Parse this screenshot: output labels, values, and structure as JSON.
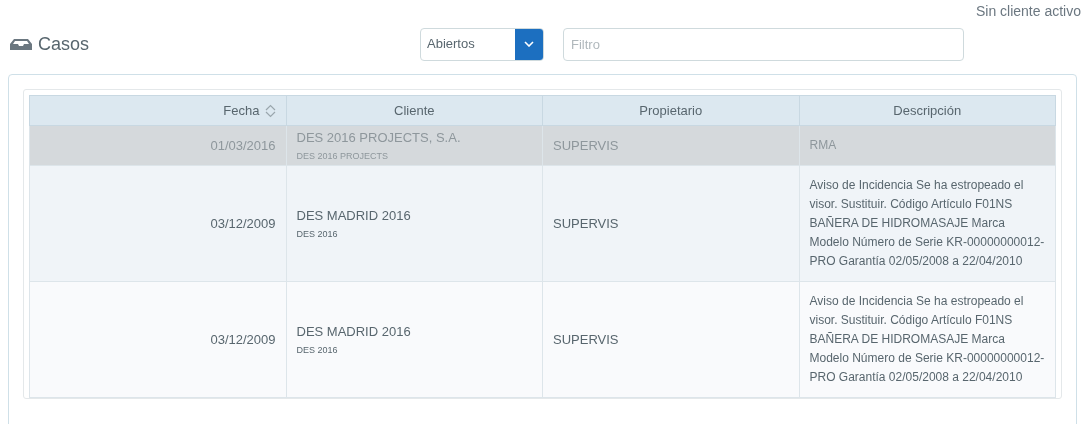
{
  "status": "Sin cliente activo",
  "title": "Casos",
  "state_select": {
    "value": "Abiertos"
  },
  "filter": {
    "placeholder": "Filtro"
  },
  "table": {
    "columns": [
      {
        "label": "Fecha",
        "sortable": true
      },
      {
        "label": "Cliente",
        "sortable": false
      },
      {
        "label": "Propietario",
        "sortable": false
      },
      {
        "label": "Descripción",
        "sortable": false
      }
    ],
    "rows": [
      {
        "selected": true,
        "date": "01/03/2016",
        "client": "DES 2016 PROJECTS, S.A.",
        "client_short": "DES 2016 PROJECTS",
        "owner": "SUPERVIS",
        "description": "RMA"
      },
      {
        "selected": false,
        "date": "03/12/2009",
        "client": "DES MADRID 2016",
        "client_short": "DES 2016",
        "owner": "SUPERVIS",
        "description": "Aviso de Incidencia Se ha estropeado el visor. Sustituir. Código Artículo F01NS BAÑERA DE HIDROMASAJE Marca Modelo Número de Serie KR-00000000012-PRO Garantía 02/05/2008 a 22/04/2010"
      },
      {
        "selected": false,
        "date": "03/12/2009",
        "client": "DES MADRID 2016",
        "client_short": "DES 2016",
        "owner": "SUPERVIS",
        "description": "Aviso de Incidencia Se ha estropeado el visor. Sustituir. Código Artículo F01NS BAÑERA DE HIDROMASAJE Marca Modelo Número de Serie KR-00000000012-PRO Garantía 02/05/2008 a 22/04/2010"
      }
    ]
  }
}
